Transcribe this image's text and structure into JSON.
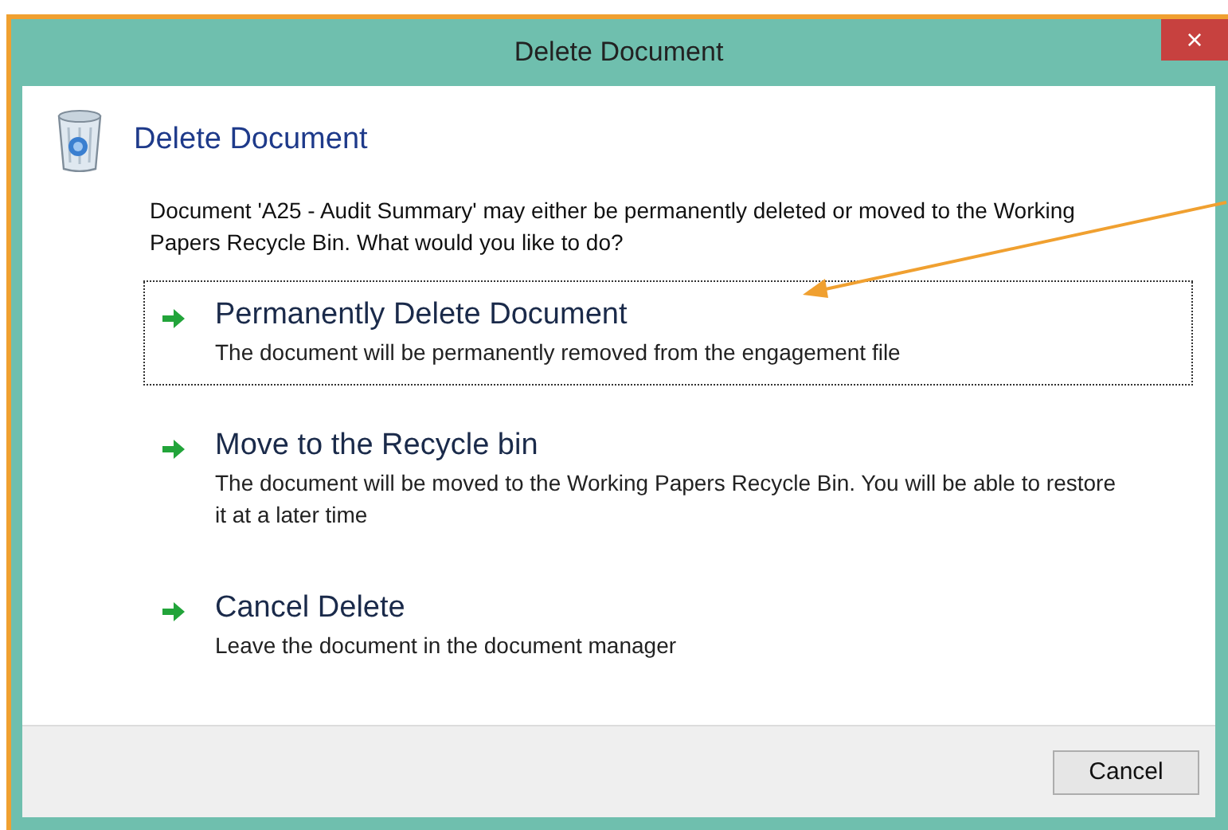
{
  "window": {
    "title": "Delete Document"
  },
  "heading": "Delete Document",
  "message": "Document 'A25 - Audit Summary' may either be permanently deleted or moved to the Working Papers Recycle Bin. What would you like to do?",
  "options": [
    {
      "title": "Permanently Delete Document",
      "description": "The document will be permanently removed from the engagement file",
      "selected": true
    },
    {
      "title": "Move to the Recycle bin",
      "description": "The document will be moved to the Working Papers Recycle Bin. You will be able to restore it at a later time",
      "selected": false
    },
    {
      "title": "Cancel Delete",
      "description": "Leave the document in the document manager",
      "selected": false
    }
  ],
  "buttons": [
    "Cancel"
  ],
  "close_button": "×"
}
